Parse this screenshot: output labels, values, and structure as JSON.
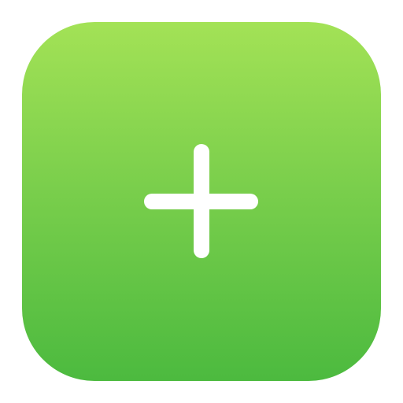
{
  "app_icon": {
    "icon": "plus-icon",
    "colors": {
      "gradient_top": "#a3e256",
      "gradient_mid": "#7bcf4c",
      "gradient_bottom": "#4cba3f",
      "glyph": "#ffffff",
      "background": "#ffffff"
    }
  }
}
